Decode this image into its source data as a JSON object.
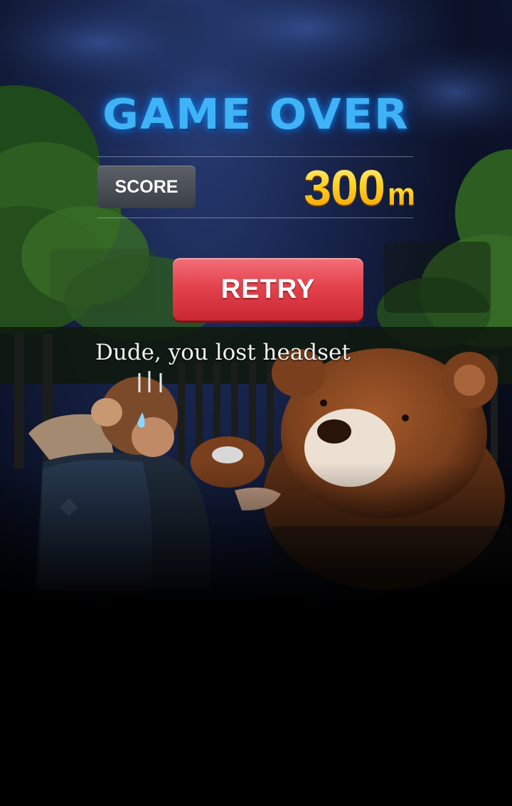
{
  "game_over": {
    "title": "GAME OVER",
    "score_label": "SCORE",
    "score_value": "300",
    "score_unit": "m",
    "retry_label": "RETRY",
    "message": "Dude, you lost headset"
  },
  "colors": {
    "title_blue": "#3fb3f5",
    "retry_red": "#e4434d",
    "score_gold": "#ffd21f",
    "bear_brown": "#8a4a22",
    "bear_muzzle": "#ece0d2"
  },
  "scene": {
    "characters": [
      "boy-with-backpack",
      "teddy-bear"
    ],
    "setting": "night forest with fence"
  }
}
